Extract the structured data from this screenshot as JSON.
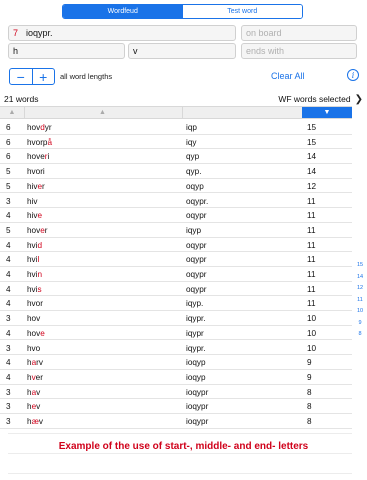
{
  "tabs": [
    {
      "label": "Wordfeud",
      "active": true
    },
    {
      "label": "Test word",
      "active": false
    }
  ],
  "letters_input": {
    "count": "7",
    "value": "ioqypr."
  },
  "on_board": {
    "placeholder": "on board"
  },
  "start_input": {
    "value": "h"
  },
  "middle_input": {
    "value": "v"
  },
  "ends_with": {
    "placeholder": "ends with"
  },
  "stepper": {
    "minus": "−",
    "plus": "+"
  },
  "length_label": "all word lengths",
  "clear_all": "Clear All",
  "info_symbol": "i",
  "summary": {
    "count_text": "21 words",
    "selected_text": "WF words selected",
    "chevron": "❯"
  },
  "table_header": {
    "c1": "▲",
    "c2": "▲",
    "c4": "▼"
  },
  "rows": [
    {
      "len": "6",
      "pre": "hov",
      "mid": "d",
      "post": "yr",
      "letters": "iqp",
      "score": "15"
    },
    {
      "len": "6",
      "pre": "hvorp",
      "mid": "å",
      "post": "",
      "letters": "iqy",
      "score": "15"
    },
    {
      "len": "6",
      "pre": "hove",
      "mid": "r",
      "post": "i",
      "letters": "qyp",
      "score": "14"
    },
    {
      "len": "5",
      "pre": "hvori",
      "mid": "",
      "post": "",
      "letters": "qyp.",
      "score": "14"
    },
    {
      "len": "5",
      "pre": "hiv",
      "mid": "e",
      "post": "r",
      "letters": "oqyp",
      "score": "12"
    },
    {
      "len": "3",
      "pre": "hiv",
      "mid": "",
      "post": "",
      "letters": "oqypr.",
      "score": "11"
    },
    {
      "len": "4",
      "pre": "hiv",
      "mid": "e",
      "post": "",
      "letters": "oqypr",
      "score": "11"
    },
    {
      "len": "5",
      "pre": "hov",
      "mid": "e",
      "post": "r",
      "letters": "iqyp",
      "score": "11"
    },
    {
      "len": "4",
      "pre": "hvi",
      "mid": "d",
      "post": "",
      "letters": "oqypr",
      "score": "11"
    },
    {
      "len": "4",
      "pre": "hvi",
      "mid": "l",
      "post": "",
      "letters": "oqypr",
      "score": "11"
    },
    {
      "len": "4",
      "pre": "hvi",
      "mid": "n",
      "post": "",
      "letters": "oqypr",
      "score": "11"
    },
    {
      "len": "4",
      "pre": "hvi",
      "mid": "s",
      "post": "",
      "letters": "oqypr",
      "score": "11"
    },
    {
      "len": "4",
      "pre": "hvor",
      "mid": "",
      "post": "",
      "letters": "iqyp.",
      "score": "11"
    },
    {
      "len": "3",
      "pre": "hov",
      "mid": "",
      "post": "",
      "letters": "iqypr.",
      "score": "10"
    },
    {
      "len": "4",
      "pre": "hov",
      "mid": "e",
      "post": "",
      "letters": "iqypr",
      "score": "10"
    },
    {
      "len": "3",
      "pre": "hvo",
      "mid": "",
      "post": "",
      "letters": "iqypr.",
      "score": "10"
    },
    {
      "len": "4",
      "pre": "h",
      "mid": "a",
      "post": "rv",
      "letters": "ioqyp",
      "score": "9"
    },
    {
      "len": "4",
      "pre": "h",
      "mid": "v",
      "post": "er",
      "letters": "ioqyp",
      "score": "9"
    },
    {
      "len": "3",
      "pre": "h",
      "mid": "a",
      "post": "v",
      "letters": "ioqypr",
      "score": "8"
    },
    {
      "len": "3",
      "pre": "h",
      "mid": "e",
      "post": "v",
      "letters": "ioqypr",
      "score": "8"
    },
    {
      "len": "3",
      "pre": "h",
      "mid": "æ",
      "post": "v",
      "letters": "ioqypr",
      "score": "8"
    }
  ],
  "score_index": [
    "15",
    "14",
    "12",
    "11",
    "10",
    "9",
    "8"
  ],
  "footer": "Example of the use of start-, middle- and end- letters"
}
